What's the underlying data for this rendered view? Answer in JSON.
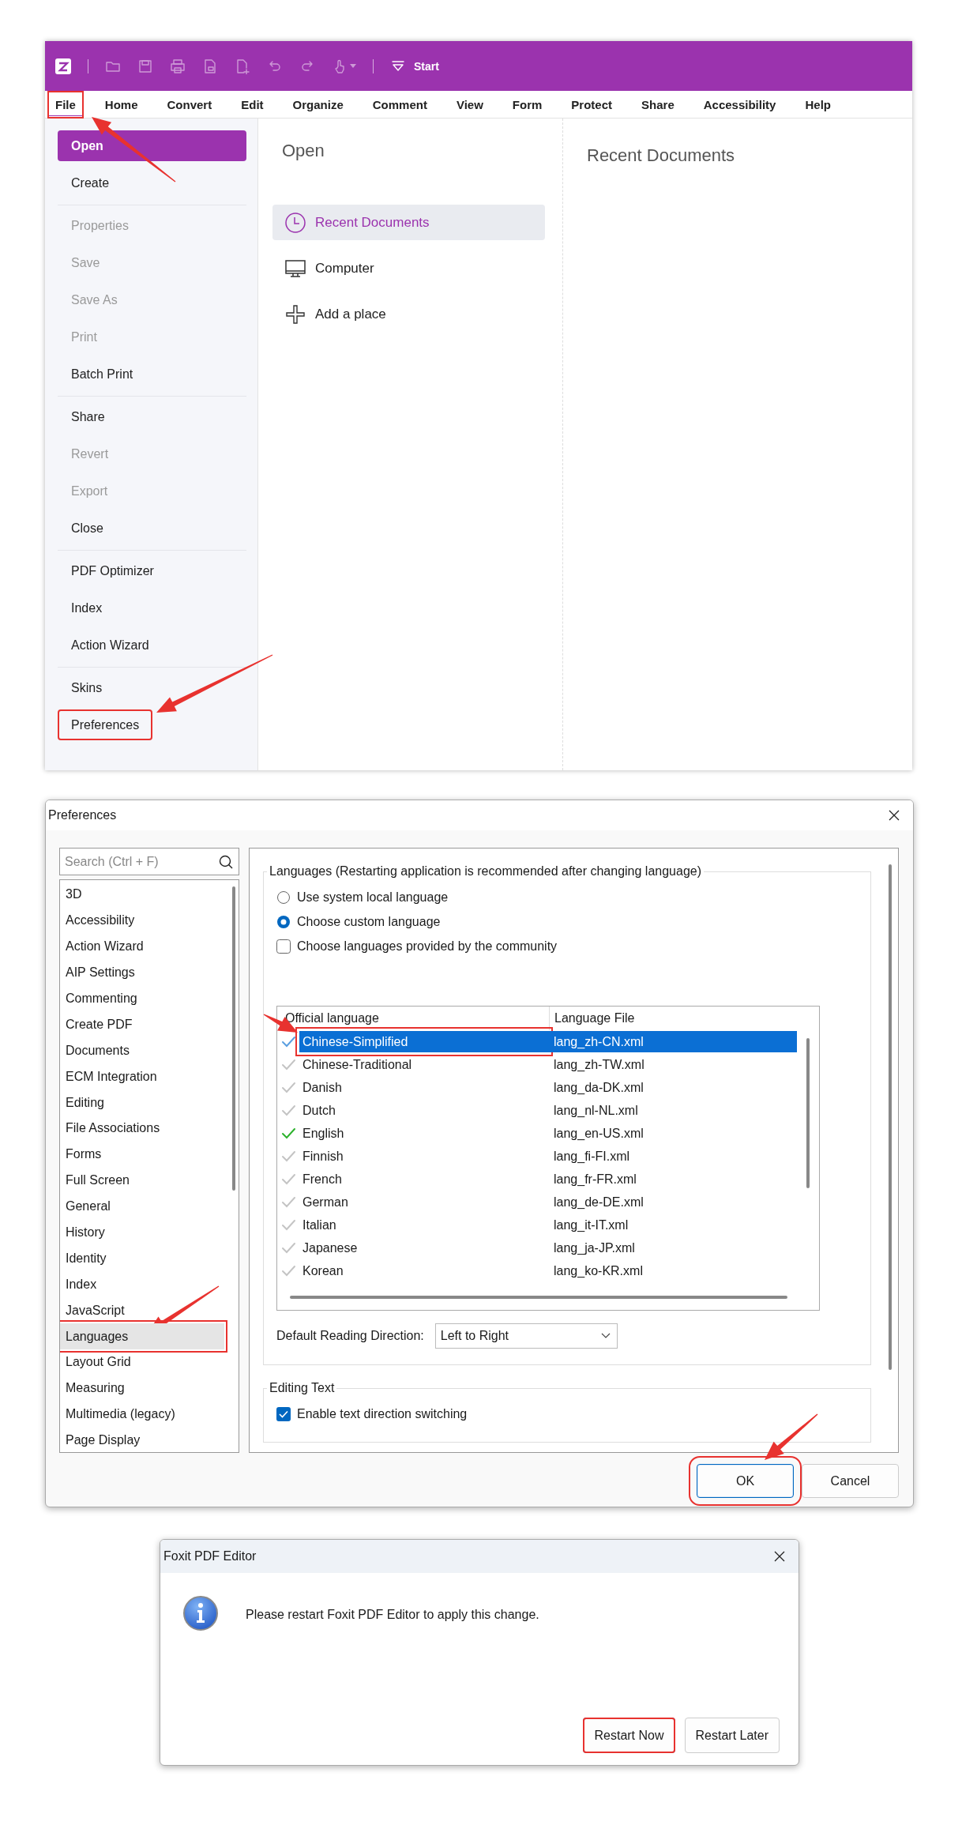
{
  "app_window": {
    "quick_access": {
      "label": "Start"
    },
    "ribbon_tabs": [
      {
        "label": "File",
        "selected": true,
        "highlighted": true
      },
      {
        "label": "Home",
        "selected": false,
        "highlighted": false
      },
      {
        "label": "Convert",
        "selected": false,
        "highlighted": false
      },
      {
        "label": "Edit",
        "selected": false,
        "highlighted": false
      },
      {
        "label": "Organize",
        "selected": false,
        "highlighted": false
      },
      {
        "label": "Comment",
        "selected": false,
        "highlighted": false
      },
      {
        "label": "View",
        "selected": false,
        "highlighted": false
      },
      {
        "label": "Form",
        "selected": false,
        "highlighted": false
      },
      {
        "label": "Protect",
        "selected": false,
        "highlighted": false
      },
      {
        "label": "Share",
        "selected": false,
        "highlighted": false
      },
      {
        "label": "Accessibility",
        "selected": false,
        "highlighted": false
      },
      {
        "label": "Help",
        "selected": false,
        "highlighted": false
      }
    ],
    "file_menu": {
      "groups": [
        {
          "items": [
            {
              "label": "Open",
              "selected": true,
              "disabled": false,
              "highlighted": false
            },
            {
              "label": "Create",
              "selected": false,
              "disabled": false,
              "highlighted": false
            }
          ]
        },
        {
          "items": [
            {
              "label": "Properties",
              "selected": false,
              "disabled": true,
              "highlighted": false
            },
            {
              "label": "Save",
              "selected": false,
              "disabled": true,
              "highlighted": false
            },
            {
              "label": "Save As",
              "selected": false,
              "disabled": true,
              "highlighted": false
            },
            {
              "label": "Print",
              "selected": false,
              "disabled": true,
              "highlighted": false
            },
            {
              "label": "Batch Print",
              "selected": false,
              "disabled": false,
              "highlighted": false
            }
          ]
        },
        {
          "items": [
            {
              "label": "Share",
              "selected": false,
              "disabled": false,
              "highlighted": false
            },
            {
              "label": "Revert",
              "selected": false,
              "disabled": true,
              "highlighted": false
            },
            {
              "label": "Export",
              "selected": false,
              "disabled": true,
              "highlighted": false
            },
            {
              "label": "Close",
              "selected": false,
              "disabled": false,
              "highlighted": false
            }
          ]
        },
        {
          "items": [
            {
              "label": "PDF Optimizer",
              "selected": false,
              "disabled": false,
              "highlighted": false
            },
            {
              "label": "Index",
              "selected": false,
              "disabled": false,
              "highlighted": false
            },
            {
              "label": "Action Wizard",
              "selected": false,
              "disabled": false,
              "highlighted": false
            }
          ]
        },
        {
          "items": [
            {
              "label": "Skins",
              "selected": false,
              "disabled": false,
              "highlighted": false
            },
            {
              "label": "Preferences",
              "selected": false,
              "disabled": false,
              "highlighted": true
            }
          ]
        }
      ]
    },
    "open_panel": {
      "heading": "Open",
      "places": [
        {
          "kind": "recent",
          "label": "Recent Documents",
          "selected": true
        },
        {
          "kind": "computer",
          "label": "Computer",
          "selected": false
        },
        {
          "kind": "add",
          "label": "Add a place",
          "selected": false
        }
      ]
    },
    "recent_panel": {
      "heading": "Recent Documents"
    }
  },
  "preferences_dialog": {
    "title": "Preferences",
    "search": {
      "placeholder": "Search (Ctrl + F)"
    },
    "categories": [
      {
        "label": "3D",
        "selected": false,
        "highlighted": false
      },
      {
        "label": "Accessibility",
        "selected": false,
        "highlighted": false
      },
      {
        "label": "Action Wizard",
        "selected": false,
        "highlighted": false
      },
      {
        "label": "AIP Settings",
        "selected": false,
        "highlighted": false
      },
      {
        "label": "Commenting",
        "selected": false,
        "highlighted": false
      },
      {
        "label": "Create PDF",
        "selected": false,
        "highlighted": false
      },
      {
        "label": "Documents",
        "selected": false,
        "highlighted": false
      },
      {
        "label": "ECM Integration",
        "selected": false,
        "highlighted": false
      },
      {
        "label": "Editing",
        "selected": false,
        "highlighted": false
      },
      {
        "label": "File Associations",
        "selected": false,
        "highlighted": false
      },
      {
        "label": "Forms",
        "selected": false,
        "highlighted": false
      },
      {
        "label": "Full Screen",
        "selected": false,
        "highlighted": false
      },
      {
        "label": "General",
        "selected": false,
        "highlighted": false
      },
      {
        "label": "History",
        "selected": false,
        "highlighted": false
      },
      {
        "label": "Identity",
        "selected": false,
        "highlighted": false
      },
      {
        "label": "Index",
        "selected": false,
        "highlighted": false
      },
      {
        "label": "JavaScript",
        "selected": false,
        "highlighted": false
      },
      {
        "label": "Languages",
        "selected": true,
        "highlighted": true
      },
      {
        "label": "Layout Grid",
        "selected": false,
        "highlighted": false
      },
      {
        "label": "Measuring",
        "selected": false,
        "highlighted": false
      },
      {
        "label": "Multimedia (legacy)",
        "selected": false,
        "highlighted": false
      },
      {
        "label": "Page Display",
        "selected": false,
        "highlighted": false
      }
    ],
    "languages_group": {
      "legend": "Languages (Restarting application is recommended after changing language)",
      "options": [
        {
          "kind": "radio",
          "label": "Use system local language",
          "selected": false
        },
        {
          "kind": "radio",
          "label": "Choose custom language",
          "selected": true
        },
        {
          "kind": "checkbox",
          "label": "Choose languages provided by the community",
          "checked": false
        }
      ],
      "table": {
        "columns": [
          "Official language",
          "Language File"
        ],
        "rows": [
          {
            "language": "Chinese-Simplified",
            "file": "lang_zh-CN.xml",
            "selected": true,
            "current": false,
            "highlighted": true
          },
          {
            "language": "Chinese-Traditional",
            "file": "lang_zh-TW.xml",
            "selected": false,
            "current": false,
            "highlighted": false
          },
          {
            "language": "Danish",
            "file": "lang_da-DK.xml",
            "selected": false,
            "current": false,
            "highlighted": false
          },
          {
            "language": "Dutch",
            "file": "lang_nl-NL.xml",
            "selected": false,
            "current": false,
            "highlighted": false
          },
          {
            "language": "English",
            "file": "lang_en-US.xml",
            "selected": false,
            "current": true,
            "highlighted": false
          },
          {
            "language": "Finnish",
            "file": "lang_fi-FI.xml",
            "selected": false,
            "current": false,
            "highlighted": false
          },
          {
            "language": "French",
            "file": "lang_fr-FR.xml",
            "selected": false,
            "current": false,
            "highlighted": false
          },
          {
            "language": "German",
            "file": "lang_de-DE.xml",
            "selected": false,
            "current": false,
            "highlighted": false
          },
          {
            "language": "Italian",
            "file": "lang_it-IT.xml",
            "selected": false,
            "current": false,
            "highlighted": false
          },
          {
            "language": "Japanese",
            "file": "lang_ja-JP.xml",
            "selected": false,
            "current": false,
            "highlighted": false
          },
          {
            "language": "Korean",
            "file": "lang_ko-KR.xml",
            "selected": false,
            "current": false,
            "highlighted": false
          }
        ]
      },
      "reading_direction": {
        "label": "Default Reading Direction:",
        "value": "Left to Right"
      }
    },
    "editing_group": {
      "legend": "Editing Text",
      "options": [
        {
          "kind": "checkbox",
          "label": "Enable text direction switching",
          "checked": true
        }
      ]
    },
    "buttons": [
      {
        "label": "OK",
        "default": true,
        "highlighted": true
      },
      {
        "label": "Cancel",
        "default": false,
        "highlighted": false
      }
    ]
  },
  "restart_dialog": {
    "title": "Foxit PDF Editor",
    "message": "Please restart Foxit PDF Editor to apply this change.",
    "buttons": [
      {
        "label": "Restart Now",
        "default": true,
        "highlighted": true
      },
      {
        "label": "Restart Later",
        "default": false,
        "highlighted": false
      }
    ]
  }
}
